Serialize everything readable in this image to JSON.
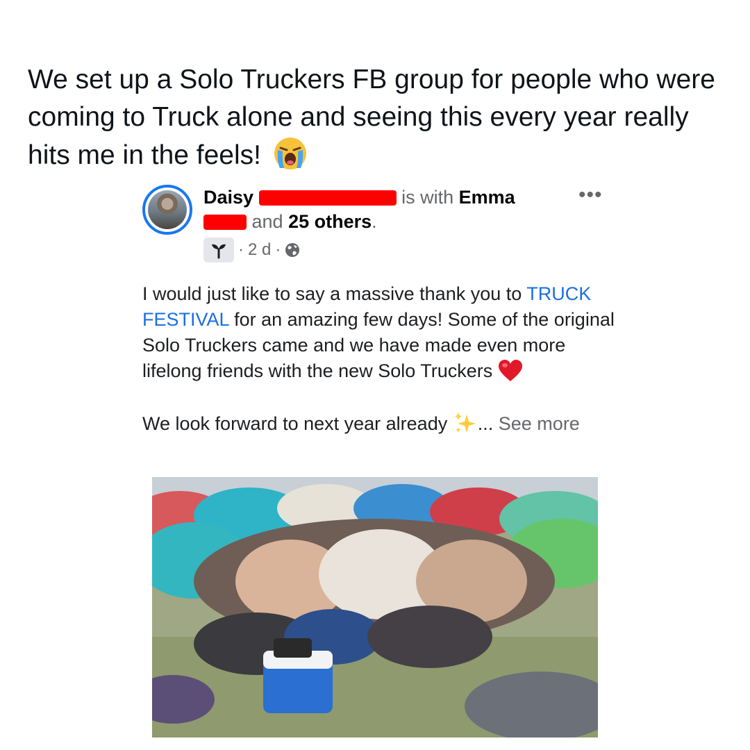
{
  "tweet": {
    "text": "We set up a Solo Truckers FB group for people who were coming to Truck alone and seeing this every year really hits me in the feels!",
    "emoji": "loudly-crying-face"
  },
  "fb_post": {
    "author_first": "Daisy",
    "with_word": "is with",
    "tagged_first": "Emma",
    "and_word": "and",
    "others": "25 others",
    "period": ".",
    "meta_sep": "·",
    "time": "2 d",
    "audience_icon": "globe-icon",
    "badge_icon": "sprout-icon",
    "more_label": "•••",
    "body_line1": "I would just like to say a massive thank you to",
    "link_text": "TRUCK FESTIVAL",
    "body_line2": "for an amazing few days! Some of the original Solo Truckers came and we have made even more lifelong friends with the new Solo Truckers",
    "body_line3": "We look forward to next year already",
    "ellipsis": "...",
    "see_more": "See more",
    "redaction_color": "#ff0000",
    "accent_color": "#1877f2",
    "link_color": "#1a6ee3"
  }
}
